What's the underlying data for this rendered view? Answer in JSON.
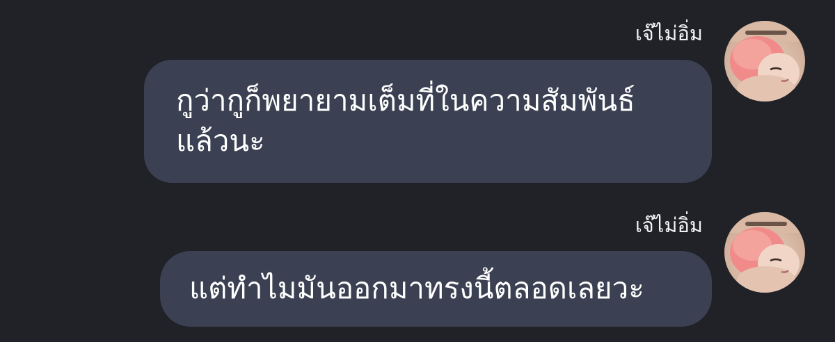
{
  "messages": [
    {
      "sender": "เจ๊ไม่อิ่ม",
      "lines": [
        "กูว่ากูก็พยายามเต็มที่ในความสัมพันธ์",
        "แล้วนะ"
      ]
    },
    {
      "sender": "เจ๊ไม่อิ่ม",
      "lines": [
        "แต่ทำไมมันออกมาทรงนี้ตลอดเลยวะ"
      ]
    }
  ],
  "colors": {
    "background": "#212228",
    "bubble": "#3b4152",
    "text": "#ffffff"
  }
}
